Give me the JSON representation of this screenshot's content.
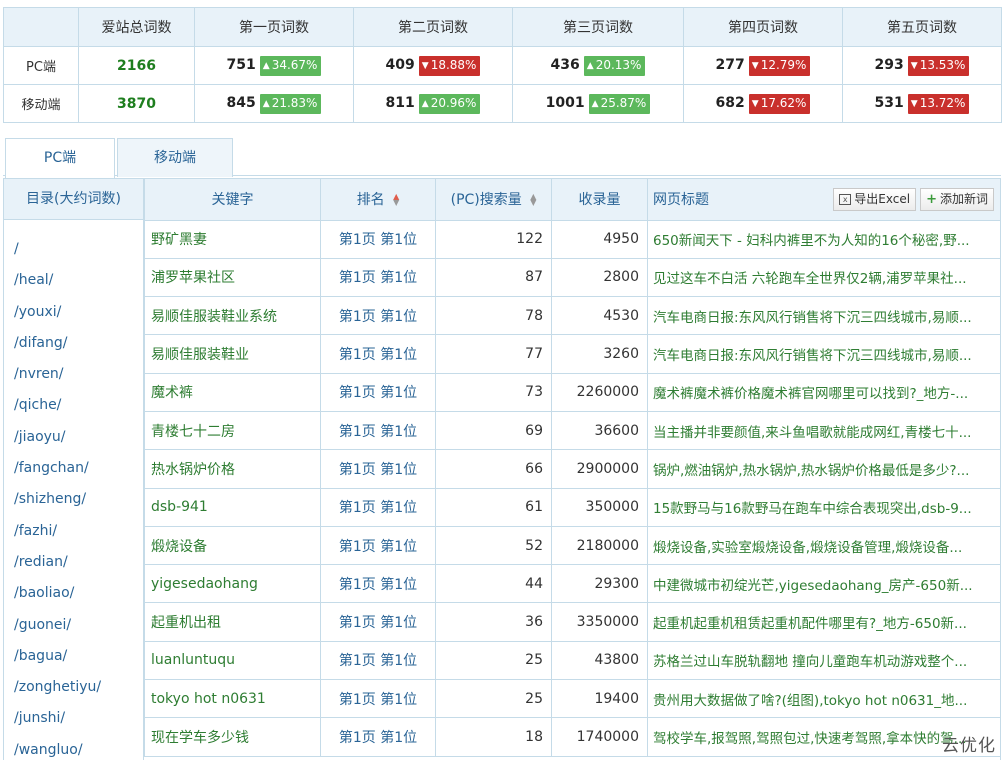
{
  "summary": {
    "headers": [
      "",
      "爱站总词数",
      "第一页词数",
      "第二页词数",
      "第三页词数",
      "第四页词数",
      "第五页词数"
    ],
    "rows": [
      {
        "label": "PC端",
        "total": "2166",
        "pages": [
          {
            "value": "751",
            "change": "34.67%",
            "dir": "up"
          },
          {
            "value": "409",
            "change": "18.88%",
            "dir": "down"
          },
          {
            "value": "436",
            "change": "20.13%",
            "dir": "up"
          },
          {
            "value": "277",
            "change": "12.79%",
            "dir": "down"
          },
          {
            "value": "293",
            "change": "13.53%",
            "dir": "down"
          }
        ]
      },
      {
        "label": "移动端",
        "total": "3870",
        "pages": [
          {
            "value": "845",
            "change": "21.83%",
            "dir": "up"
          },
          {
            "value": "811",
            "change": "20.96%",
            "dir": "up"
          },
          {
            "value": "1001",
            "change": "25.87%",
            "dir": "up"
          },
          {
            "value": "682",
            "change": "17.62%",
            "dir": "down"
          },
          {
            "value": "531",
            "change": "13.72%",
            "dir": "down"
          }
        ]
      }
    ]
  },
  "tabs": [
    {
      "label": "PC端",
      "active": true
    },
    {
      "label": "移动端",
      "active": false
    }
  ],
  "sidebar": {
    "title": "目录(大约词数)",
    "items": [
      "/",
      "/heal/",
      "/youxi/",
      "/difang/",
      "/nvren/",
      "/qiche/",
      "/jiaoyu/",
      "/fangchan/",
      "/shizheng/",
      "/fazhi/",
      "/redian/",
      "/baoliao/",
      "/guonei/",
      "/bagua/",
      "/zonghetiyu/",
      "/junshi/",
      "/wangluo/"
    ]
  },
  "table": {
    "columns": {
      "keyword": "关键字",
      "rank": "排名",
      "search": "(PC)搜索量",
      "indexed": "收录量",
      "title": "网页标题"
    },
    "export_label": "导出Excel",
    "add_label": "添加新词",
    "rows": [
      {
        "keyword": "野矿黑妻",
        "rank": "第1页 第1位",
        "search": "122",
        "indexed": "4950",
        "title": "650新闻天下 - 妇科内裤里不为人知的16个秘密,野..."
      },
      {
        "keyword": "浦罗苹果社区",
        "rank": "第1页 第1位",
        "search": "87",
        "indexed": "2800",
        "title": "见过这车不白活 六轮跑车全世界仅2辆,浦罗苹果社..."
      },
      {
        "keyword": "易顺佳服装鞋业系统",
        "rank": "第1页 第1位",
        "search": "78",
        "indexed": "4530",
        "title": "汽车电商日报:东风风行销售将下沉三四线城市,易顺..."
      },
      {
        "keyword": "易顺佳服装鞋业",
        "rank": "第1页 第1位",
        "search": "77",
        "indexed": "3260",
        "title": "汽车电商日报:东风风行销售将下沉三四线城市,易顺..."
      },
      {
        "keyword": "魔术裤",
        "rank": "第1页 第1位",
        "search": "73",
        "indexed": "2260000",
        "title": "魔术裤魔术裤价格魔术裤官网哪里可以找到?_地方-..."
      },
      {
        "keyword": "青楼七十二房",
        "rank": "第1页 第1位",
        "search": "69",
        "indexed": "36600",
        "title": "当主播并非要颜值,来斗鱼唱歌就能成网红,青楼七十..."
      },
      {
        "keyword": "热水锅炉价格",
        "rank": "第1页 第1位",
        "search": "66",
        "indexed": "2900000",
        "title": "锅炉,燃油锅炉,热水锅炉,热水锅炉价格最低是多少?..."
      },
      {
        "keyword": "dsb-941",
        "rank": "第1页 第1位",
        "search": "61",
        "indexed": "350000",
        "title": "15款野马与16款野马在跑车中综合表现突出,dsb-9..."
      },
      {
        "keyword": "煅烧设备",
        "rank": "第1页 第1位",
        "search": "52",
        "indexed": "2180000",
        "title": "煅烧设备,实验室煅烧设备,煅烧设备管理,煅烧设备..."
      },
      {
        "keyword": "yigesedaohang",
        "rank": "第1页 第1位",
        "search": "44",
        "indexed": "29300",
        "title": "中建微城市初绽光芒,yigesedaohang_房产-650新..."
      },
      {
        "keyword": "起重机出租",
        "rank": "第1页 第1位",
        "search": "36",
        "indexed": "3350000",
        "title": "起重机起重机租赁起重机配件哪里有?_地方-650新..."
      },
      {
        "keyword": "luanluntuqu",
        "rank": "第1页 第1位",
        "search": "25",
        "indexed": "43800",
        "title": "苏格兰过山车脱轨翻地 撞向儿童跑车机动游戏整个..."
      },
      {
        "keyword": "tokyo hot n0631",
        "rank": "第1页 第1位",
        "search": "25",
        "indexed": "19400",
        "title": "贵州用大数据做了啥?(组图),tokyo hot n0631_地..."
      },
      {
        "keyword": "现在学车多少钱",
        "rank": "第1页 第1位",
        "search": "18",
        "indexed": "1740000",
        "title": "驾校学车,报驾照,驾照包过,快速考驾照,拿本快的驾..."
      }
    ]
  },
  "watermark": "云优化",
  "colors": {
    "up": "#5cb85c",
    "down": "#c9302c",
    "header_bg": "#e8f2f9",
    "link": "#2a6496",
    "keyword": "#2e7d32"
  }
}
